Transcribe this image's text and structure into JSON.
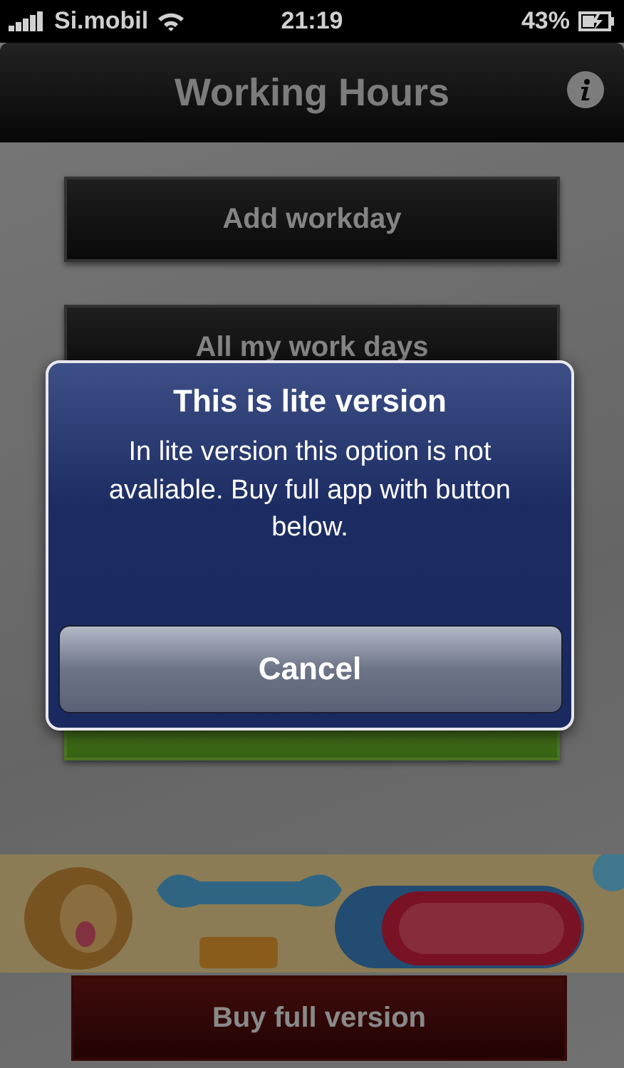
{
  "status_bar": {
    "carrier": "Si.mobil",
    "time": "21:19",
    "battery": "43%"
  },
  "nav_bar": {
    "title": "Working Hours"
  },
  "menu": [
    {
      "label": "Add workday",
      "kind": "dark"
    },
    {
      "label": "All my work days",
      "kind": "dark"
    },
    {
      "kind": "green"
    }
  ],
  "buy_button": {
    "label": "Buy full version"
  },
  "alert": {
    "title": "This is lite version",
    "message": "In lite version this option is not avaliable. Buy full app with button below.",
    "buttons": [
      "Cancel"
    ]
  }
}
